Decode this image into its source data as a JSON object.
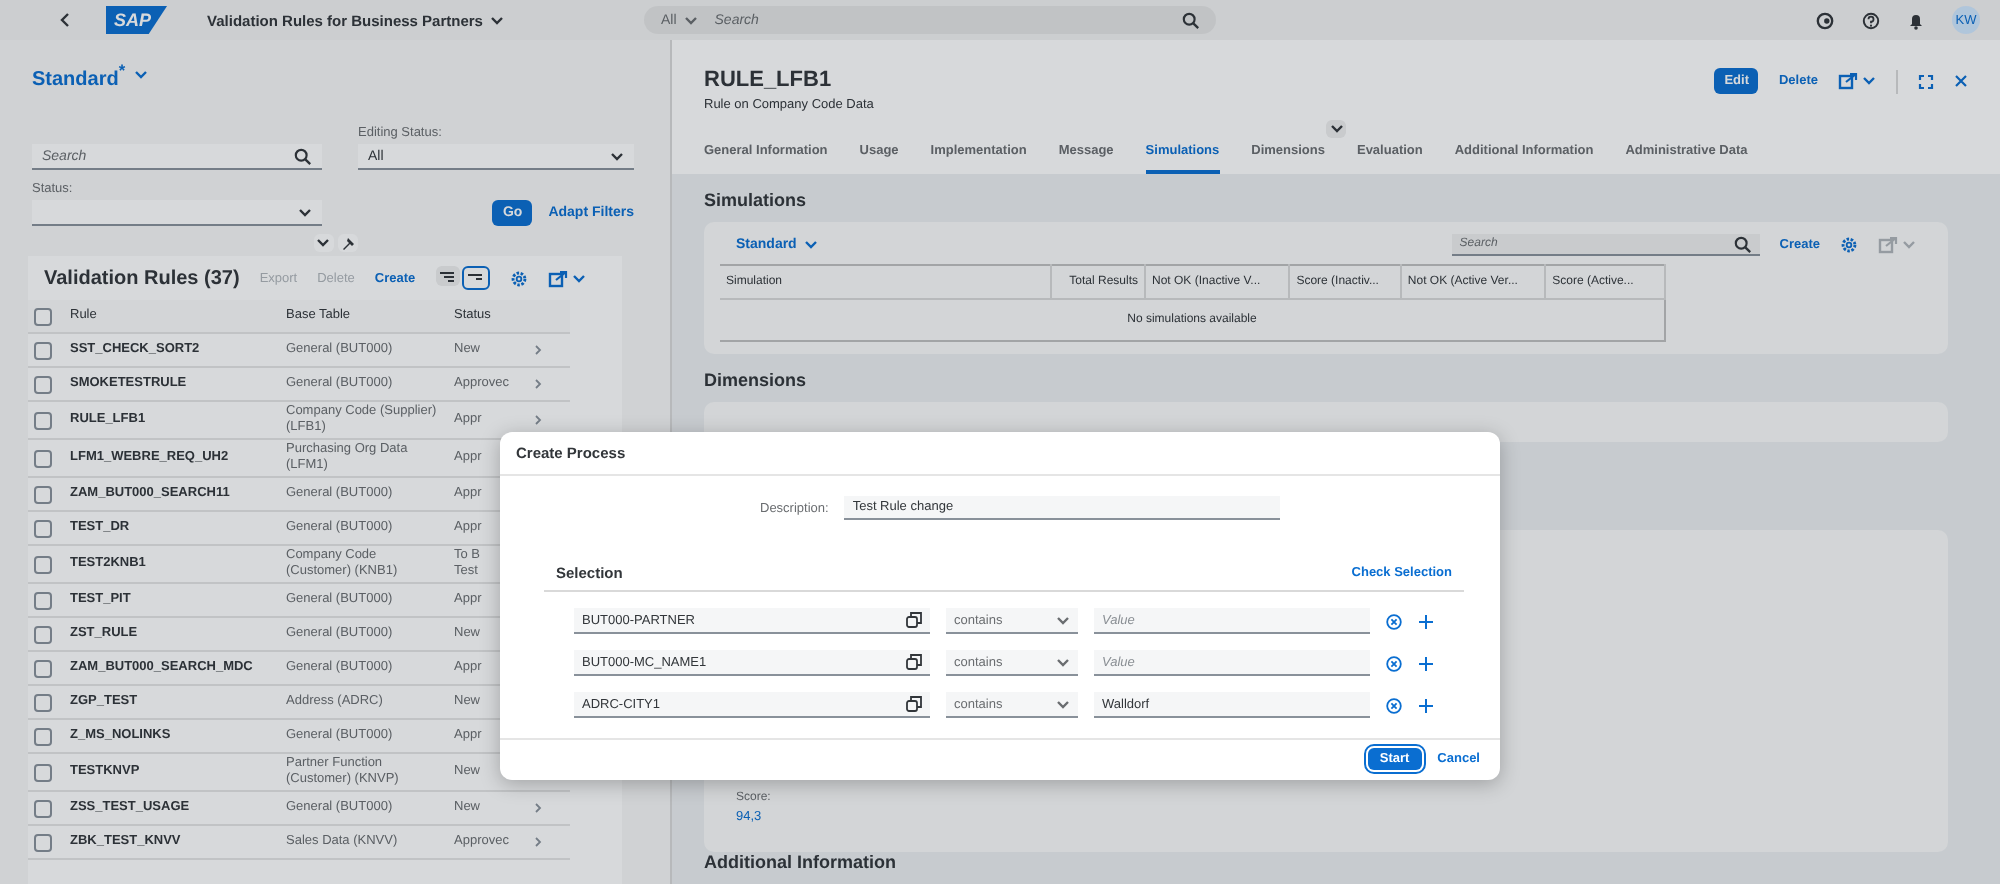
{
  "shell": {
    "logo": "SAP",
    "title": "Validation Rules for Business Partners",
    "search": {
      "scope": "All",
      "placeholder": "Search"
    },
    "avatar": "KW"
  },
  "left": {
    "variant": "Standard$^{*}$",
    "filters": {
      "search_placeholder": "Search",
      "editing_status": {
        "label": "Editing Status:",
        "value": "All"
      },
      "status": {
        "label": "Status:"
      },
      "go": "Go",
      "adapt": "Adapt Filters"
    },
    "table": {
      "title": "Validation Rules (37)",
      "actions": [
        {
          "label": "Export",
          "disabled": true
        },
        {
          "label": "Delete",
          "disabled": true
        },
        {
          "label": "Create",
          "disabled": false
        }
      ],
      "view_toggles": [
        {
          "selected": false
        },
        {
          "selected": true
        }
      ],
      "columns": [
        "Rule",
        "Base Table",
        "Status"
      ],
      "header_checked": false,
      "rows": [
        {
          "rule": "SST_CHECK_SORT2",
          "base": "General (BUT000)",
          "status": "New",
          "checked": false
        },
        {
          "rule": "SMOKETESTRULE",
          "base": "General (BUT000)",
          "status": "Approvec",
          "checked": false
        },
        {
          "rule": "RULE_LFB1",
          "base": "Company Code (Supplier) (LFB1)",
          "status": "Appr",
          "checked": false
        },
        {
          "rule": "LFM1_WEBRE_REQ_UH2",
          "base": "Purchasing Org Data (LFM1)",
          "status": "Appr",
          "checked": false
        },
        {
          "rule": "ZAM_BUT000_SEARCH11",
          "base": "General (BUT000)",
          "status": "Appr",
          "checked": false
        },
        {
          "rule": "TEST_DR",
          "base": "General (BUT000)",
          "status": "Appr",
          "checked": false
        },
        {
          "rule": "TEST2KNB1",
          "base": "Company Code (Customer) (KNB1)",
          "status": "To B\nTest",
          "checked": false
        },
        {
          "rule": "TEST_PIT",
          "base": "General (BUT000)",
          "status": "Appr",
          "checked": false
        },
        {
          "rule": "ZST_RULE",
          "base": "General (BUT000)",
          "status": "New",
          "checked": false
        },
        {
          "rule": "ZAM_BUT000_SEARCH_MDC",
          "base": "General (BUT000)",
          "status": "Appr",
          "checked": false
        },
        {
          "rule": "ZGP_TEST",
          "base": "Address (ADRC)",
          "status": "New",
          "checked": false
        },
        {
          "rule": "Z_MS_NOLINKS",
          "base": "General (BUT000)",
          "status": "Appr",
          "checked": false
        },
        {
          "rule": "TESTKNVP",
          "base": "Partner Function (Customer) (KNVP)",
          "status": "New",
          "checked": false
        },
        {
          "rule": "ZSS_TEST_USAGE",
          "base": "General (BUT000)",
          "status": "New",
          "checked": false
        },
        {
          "rule": "ZBK_TEST_KNVV",
          "base": "Sales Data (KNVV)",
          "status": "Approvec",
          "checked": false
        }
      ]
    }
  },
  "detail": {
    "title": "RULE_LFB1",
    "subtitle": "Rule on  Company Code Data",
    "actions": {
      "edit": "Edit",
      "delete": "Delete"
    },
    "tabs": [
      {
        "label": "General Information",
        "selected": false
      },
      {
        "label": "Usage",
        "selected": false
      },
      {
        "label": "Implementation",
        "selected": false
      },
      {
        "label": "Message",
        "selected": false
      },
      {
        "label": "Simulations",
        "selected": true
      },
      {
        "label": "Dimensions",
        "selected": false
      },
      {
        "label": "Evaluation",
        "selected": false
      },
      {
        "label": "Additional Information",
        "selected": false
      },
      {
        "label": "Administrative Data",
        "selected": false
      }
    ],
    "simulations": {
      "title": "Simulations",
      "variant": "Standard",
      "search_placeholder": "Search",
      "create": "Create",
      "columns": [
        "Simulation",
        "Total Results",
        "Not OK (Inactive V...",
        "Score (Inactiv...",
        "Not OK (Active Ver...",
        "Score (Active..."
      ],
      "empty": "No simulations available"
    },
    "dimensions": {
      "title": "Dimensions"
    },
    "evaluation": {
      "score_label": "Score:",
      "score": "94,3"
    },
    "additional": {
      "title": "Additional Information"
    }
  },
  "dialog": {
    "title": "Create Process",
    "description_label": "Description:",
    "description": "Test Rule change",
    "selection_title": "Selection",
    "check": "Check Selection",
    "rows": [
      {
        "field": "BUT000-PARTNER",
        "operator": "contains",
        "placeholder": "Value"
      },
      {
        "field": "BUT000-MC_NAME1",
        "operator": "contains",
        "placeholder": "Value"
      },
      {
        "field": "ADRC-CITY1",
        "operator": "contains",
        "value": "Walldorf"
      }
    ],
    "buttons": {
      "start": "Start",
      "cancel": "Cancel"
    }
  }
}
